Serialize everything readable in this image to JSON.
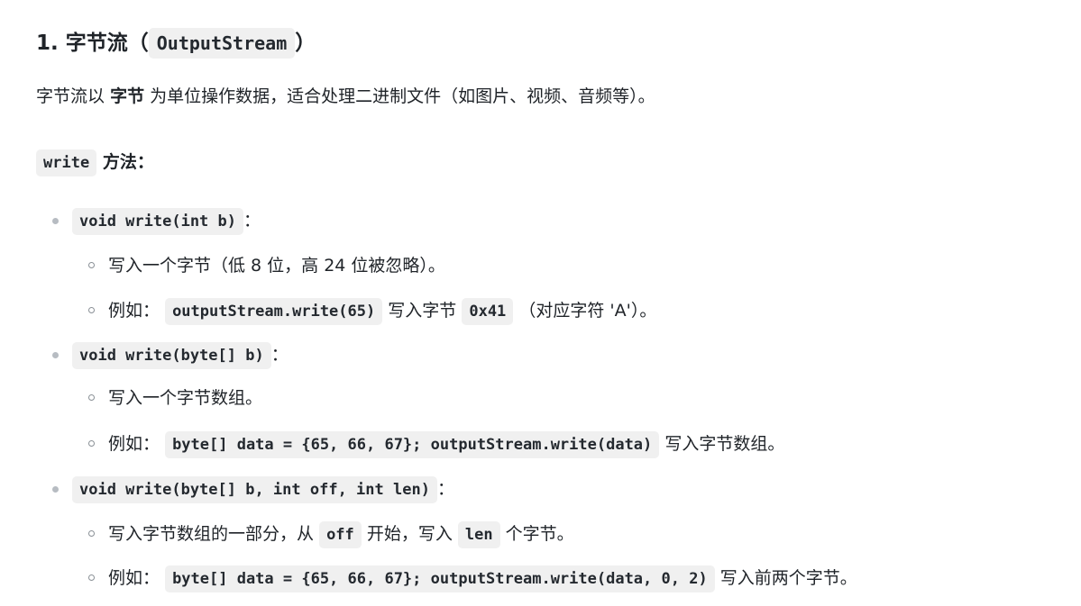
{
  "heading": {
    "number": "1.",
    "title": "字节流",
    "open_paren": "（",
    "code": "OutputStream",
    "close_paren": "）"
  },
  "intro": {
    "prefix": "字节流以",
    "bold": "字节",
    "suffix": "为单位操作数据，适合处理二进制文件（如图片、视频、音频等）。"
  },
  "write_section": {
    "code": "write",
    "label": "方法："
  },
  "methods": [
    {
      "signature": "void write(int b)",
      "colon": "：",
      "desc": "写入一个字节（低 8 位，高 24 位被忽略）。",
      "example_prefix": "例如：",
      "example_code": "outputStream.write(65)",
      "example_mid": "写入字节",
      "example_code2": "0x41",
      "example_suffix": "（对应字符 'A'）。"
    },
    {
      "signature": "void write(byte[] b)",
      "colon": "：",
      "desc": "写入一个字节数组。",
      "example_prefix": "例如：",
      "example_code": "byte[] data = {65, 66, 67}; outputStream.write(data)",
      "example_suffix": "写入字节数组。"
    },
    {
      "signature": "void write(byte[] b, int off, int len)",
      "colon": "：",
      "desc_prefix": "写入字节数组的一部分，从",
      "desc_code1": "off",
      "desc_mid": "开始，写入",
      "desc_code2": "len",
      "desc_suffix": "个字节。",
      "example_prefix": "例如：",
      "example_code": "byte[] data = {65, 66, 67}; outputStream.write(data, 0, 2)",
      "example_suffix": "写入前两个字节。"
    }
  ]
}
